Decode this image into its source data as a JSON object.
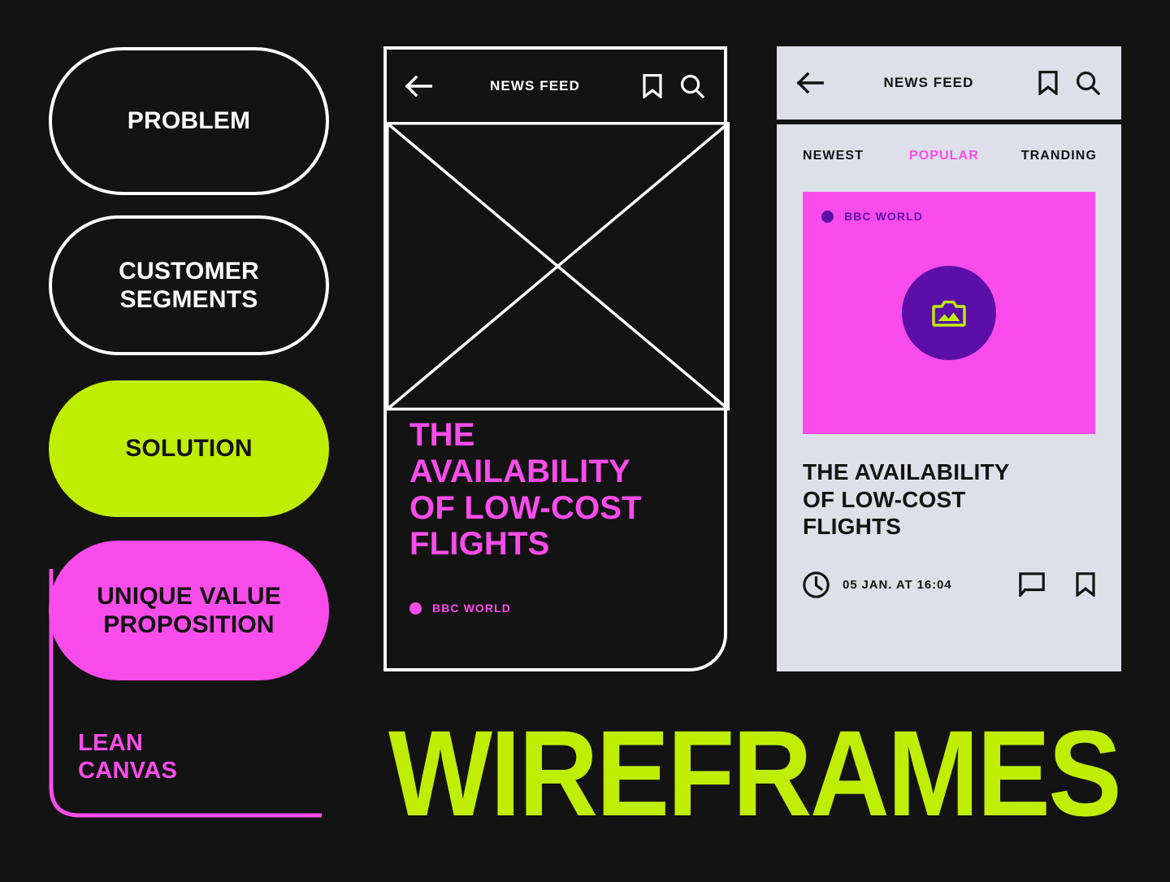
{
  "canvas": {
    "background_color": "#131313",
    "accent_lime": "#bfee04",
    "accent_pink": "#fa4ceb",
    "accent_purple": "#5b0fa8",
    "light_surface": "#dde0e9",
    "white": "#ffffff"
  },
  "lean_canvas": {
    "label": "LEAN\nCANVAS",
    "blocks": [
      {
        "label": "PROBLEM",
        "style": "outline",
        "name": "problem"
      },
      {
        "label": "CUSTOMER\nSEGMENTS",
        "style": "outline",
        "name": "customer-segments"
      },
      {
        "label": "SOLUTION",
        "style": "lime",
        "name": "solution"
      },
      {
        "label": "UNIQUE VALUE\nPROPOSITION",
        "style": "pink",
        "name": "unique-value-proposition"
      }
    ]
  },
  "phone_dark": {
    "header": {
      "title": "NEWS FEED",
      "back_icon": "arrow-left-icon",
      "bookmark_icon": "bookmark-icon",
      "search_icon": "search-icon"
    },
    "media_placeholder": "image-placeholder-crossbox",
    "headline": "THE\nAVAILABILITY\nOF LOW-COST\nFLIGHTS",
    "source": "BBC WORLD"
  },
  "phone_light": {
    "header": {
      "title": "NEWS FEED",
      "back_icon": "arrow-left-icon",
      "bookmark_icon": "bookmark-icon",
      "search_icon": "search-icon"
    },
    "tabs": [
      {
        "label": "NEWEST",
        "active": false
      },
      {
        "label": "POPULAR",
        "active": true
      },
      {
        "label": "TRANDING",
        "active": false
      }
    ],
    "card": {
      "source": "BBC WORLD",
      "thumbnail_icon": "image-icon",
      "title": "THE AVAILABILITY\nOF LOW-COST\nFLIGHTS",
      "timestamp": "05 JAN. AT 16:04",
      "clock_icon": "clock-icon",
      "comment_icon": "comment-icon",
      "bookmark_icon": "bookmark-icon"
    }
  },
  "wordmark": {
    "text": "WIREFRAMES",
    "color": "#bfee04"
  }
}
